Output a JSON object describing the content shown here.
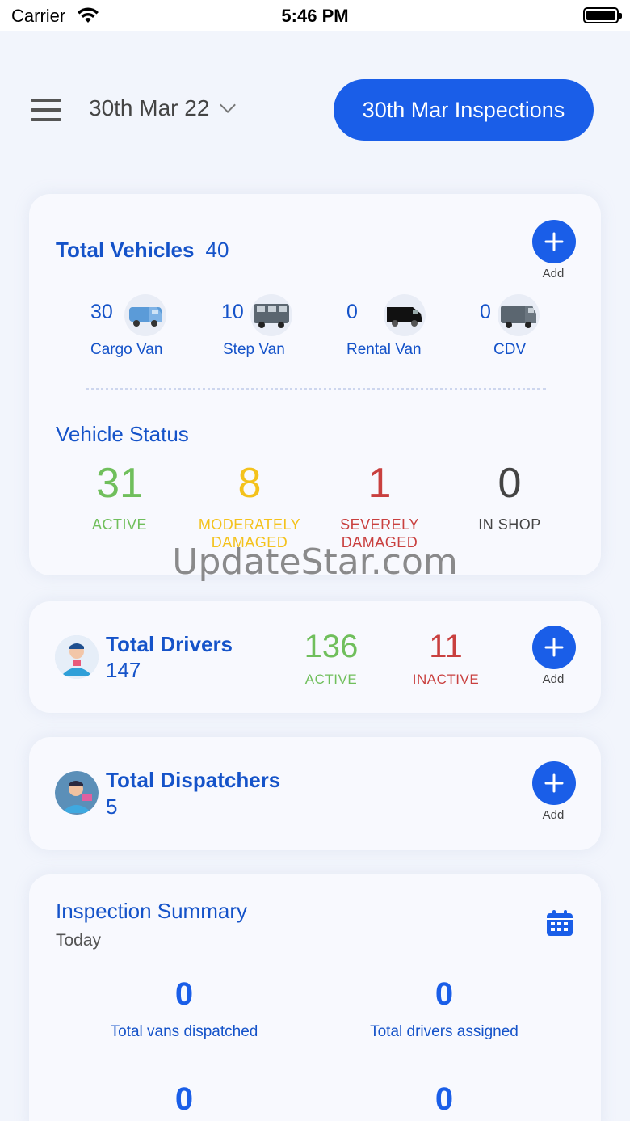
{
  "status_bar": {
    "carrier": "Carrier",
    "time": "5:46 PM"
  },
  "header": {
    "date": "30th Mar 22",
    "inspections_button": "30th Mar Inspections"
  },
  "vehicles": {
    "title": "Total Vehicles",
    "total": "40",
    "add_label": "Add",
    "types": [
      {
        "count": "30",
        "label": "Cargo Van",
        "icon": "cargo-van-icon"
      },
      {
        "count": "10",
        "label": "Step Van",
        "icon": "step-van-icon"
      },
      {
        "count": "0",
        "label": "Rental Van",
        "icon": "rental-van-icon"
      },
      {
        "count": "0",
        "label": "CDV",
        "icon": "cdv-icon"
      }
    ],
    "status_title": "Vehicle Status",
    "status": [
      {
        "value": "31",
        "label": "ACTIVE",
        "color": "#70bf5c"
      },
      {
        "value": "8",
        "label": "MODERATELY DAMAGED",
        "color": "#f4c21c"
      },
      {
        "value": "1",
        "label": "SEVERELY DAMAGED",
        "color": "#c9403f"
      },
      {
        "value": "0",
        "label": "IN SHOP",
        "color": "#444444"
      }
    ]
  },
  "watermark": "UpdateStar.com",
  "drivers": {
    "title": "Total Drivers",
    "total": "147",
    "active_value": "136",
    "active_label": "ACTIVE",
    "inactive_value": "11",
    "inactive_label": "INACTIVE",
    "add_label": "Add"
  },
  "dispatchers": {
    "title": "Total Dispatchers",
    "total": "5",
    "add_label": "Add"
  },
  "summary": {
    "title": "Inspection Summary",
    "period": "Today",
    "items": [
      {
        "value": "0",
        "label": "Total vans dispatched"
      },
      {
        "value": "0",
        "label": "Total drivers assigned"
      },
      {
        "value": "0",
        "label": ""
      },
      {
        "value": "0",
        "label": ""
      }
    ]
  },
  "colors": {
    "accent": "#1a5ee8",
    "title_blue": "#1553c9"
  }
}
